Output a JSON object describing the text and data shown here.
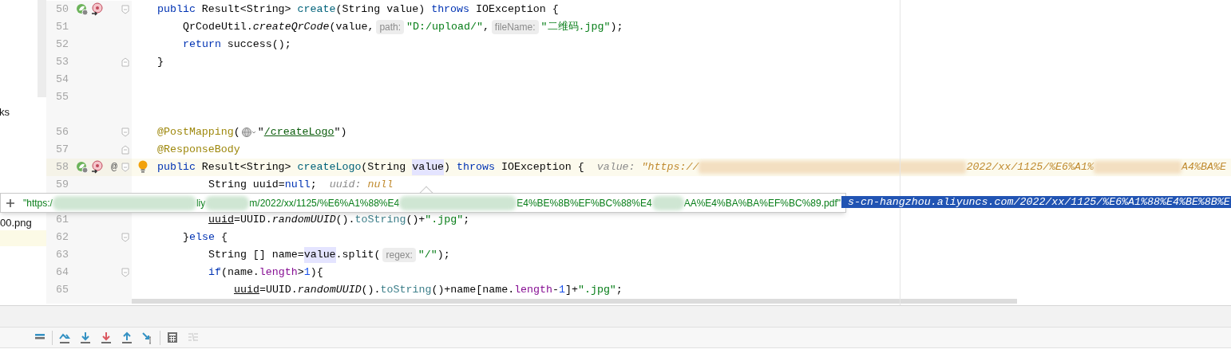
{
  "project_panel": {
    "items": [
      {
        "text": "ks"
      },
      {
        "text": "00.png"
      }
    ]
  },
  "editor": {
    "lines": [
      {
        "number": "50",
        "kind": "member",
        "run_marker": true,
        "impl_marker": true,
        "fold_start": true,
        "highlighted": false,
        "tokens": [
          {
            "kind": "keyword",
            "text": "public"
          },
          {
            "kind": "plain",
            "text": " Result<String> "
          },
          {
            "kind": "method",
            "text": "create"
          },
          {
            "kind": "plain",
            "text": "(String value) "
          },
          {
            "kind": "keyword",
            "text": "throws"
          },
          {
            "kind": "plain",
            "text": " IOException {"
          }
        ]
      },
      {
        "number": "51",
        "kind": "body",
        "highlighted": false,
        "tokens": [
          {
            "kind": "plain",
            "text": "QrCodeUtil."
          },
          {
            "kind": "static",
            "text": "createQrCode"
          },
          {
            "kind": "plain",
            "text": "(value,"
          },
          {
            "kind": "hint",
            "text": "path:"
          },
          {
            "kind": "string",
            "text": "\"D:/upload/\""
          },
          {
            "kind": "plain",
            "text": ","
          },
          {
            "kind": "hint",
            "text": "fileName:"
          },
          {
            "kind": "string",
            "text": "\"二维码.jpg\""
          },
          {
            "kind": "plain",
            "text": ");"
          }
        ]
      },
      {
        "number": "52",
        "kind": "body",
        "highlighted": false,
        "tokens": [
          {
            "kind": "keyword",
            "text": "return"
          },
          {
            "kind": "plain",
            "text": " success();"
          }
        ]
      },
      {
        "number": "53",
        "kind": "member",
        "fold_end": true,
        "highlighted": false,
        "tokens": [
          {
            "kind": "plain",
            "text": "}"
          }
        ]
      },
      {
        "number": "54",
        "kind": "member",
        "highlighted": false
      },
      {
        "number": "55",
        "kind": "member",
        "highlighted": false
      },
      {
        "number": "56",
        "kind": "member",
        "fold_start": true,
        "gap_before": true,
        "highlighted": false,
        "tokens": [
          {
            "kind": "annotation",
            "text": "@PostMapping"
          },
          {
            "kind": "plain",
            "text": "("
          },
          {
            "kind": "globe"
          },
          {
            "kind": "plain",
            "text": "\""
          },
          {
            "kind": "link",
            "text": "/createLogo"
          },
          {
            "kind": "plain",
            "text": "\")"
          }
        ]
      },
      {
        "number": "57",
        "kind": "member",
        "fold_end": true,
        "highlighted": false,
        "tokens": [
          {
            "kind": "annotation",
            "text": "@ResponseBody"
          }
        ]
      },
      {
        "number": "58",
        "kind": "member",
        "run_marker": true,
        "impl_marker": true,
        "mark": "@",
        "bulb": true,
        "fold_start": true,
        "highlighted": true,
        "tokens": [
          {
            "kind": "keyword",
            "text": "public"
          },
          {
            "kind": "plain",
            "text": " Result<String> "
          },
          {
            "kind": "method",
            "text": "createLogo"
          },
          {
            "kind": "plain",
            "text": "(String "
          },
          {
            "kind": "var-highlight",
            "text": "value"
          },
          {
            "kind": "plain",
            "text": ") "
          },
          {
            "kind": "keyword",
            "text": "throws"
          },
          {
            "kind": "plain",
            "text": " IOException {"
          },
          {
            "kind": "debug-label",
            "text": "value:"
          },
          {
            "kind": "debug-value",
            "text": "\"https://"
          },
          {
            "kind": "blur"
          },
          {
            "kind": "debug-value",
            "text": "2022/xx/1125/%E6%A1%"
          },
          {
            "kind": "blur"
          },
          {
            "kind": "debug-value",
            "text": "A4%BA%E"
          }
        ]
      },
      {
        "number": "59",
        "kind": "inner",
        "highlighted": false,
        "tokens": [
          {
            "kind": "plain",
            "text": "String uuid="
          },
          {
            "kind": "keyword",
            "text": "null"
          },
          {
            "kind": "plain",
            "text": ";"
          },
          {
            "kind": "debug-label",
            "text": "uuid:"
          },
          {
            "kind": "debug-value",
            "text": "null"
          }
        ]
      },
      {
        "kind": "covered",
        "selected_tail": "s-cn-hangzhou.aliyuncs.com/2022/xx/1125/%E6%A1%88%E4%BE%8B%E"
      },
      {
        "number": "61",
        "kind": "inner",
        "highlighted": false,
        "tokens": [
          {
            "kind": "var-underline",
            "text": "uuid"
          },
          {
            "kind": "plain",
            "text": "=UUID."
          },
          {
            "kind": "static",
            "text": "randomUUID"
          },
          {
            "kind": "plain",
            "text": "()."
          },
          {
            "kind": "call",
            "text": "toString"
          },
          {
            "kind": "plain",
            "text": "()+"
          },
          {
            "kind": "string",
            "text": "\".jpg\""
          },
          {
            "kind": "plain",
            "text": ";"
          }
        ]
      },
      {
        "number": "62",
        "kind": "body",
        "fold_start": true,
        "highlighted": false,
        "tokens": [
          {
            "kind": "plain",
            "text": "}"
          },
          {
            "kind": "keyword",
            "text": "else"
          },
          {
            "kind": "plain",
            "text": " {"
          }
        ]
      },
      {
        "number": "63",
        "kind": "inner",
        "highlighted": false,
        "tokens": [
          {
            "kind": "plain",
            "text": "String [] name="
          },
          {
            "kind": "var-highlight",
            "text": "value"
          },
          {
            "kind": "plain",
            "text": ".split("
          },
          {
            "kind": "hint",
            "text": "regex:"
          },
          {
            "kind": "string",
            "text": "\"/\""
          },
          {
            "kind": "plain",
            "text": ");"
          }
        ]
      },
      {
        "number": "64",
        "kind": "inner",
        "fold_start": true,
        "highlighted": false,
        "tokens": [
          {
            "kind": "keyword",
            "text": "if"
          },
          {
            "kind": "plain",
            "text": "(name."
          },
          {
            "kind": "field",
            "text": "length"
          },
          {
            "kind": "plain",
            "text": ">"
          },
          {
            "kind": "number",
            "text": "1"
          },
          {
            "kind": "plain",
            "text": "){"
          }
        ]
      },
      {
        "number": "65",
        "kind": "deep",
        "highlighted": false,
        "tokens": [
          {
            "kind": "var-underline",
            "text": "uuid"
          },
          {
            "kind": "plain",
            "text": "=UUID."
          },
          {
            "kind": "static",
            "text": "randomUUID"
          },
          {
            "kind": "plain",
            "text": "()."
          },
          {
            "kind": "call",
            "text": "toString"
          },
          {
            "kind": "plain",
            "text": "()+name[name."
          },
          {
            "kind": "field",
            "text": "length"
          },
          {
            "kind": "plain",
            "text": "-"
          },
          {
            "kind": "number",
            "text": "1"
          },
          {
            "kind": "plain",
            "text": "]+"
          },
          {
            "kind": "string",
            "text": "\".jpg\""
          },
          {
            "kind": "plain",
            "text": ";"
          }
        ]
      }
    ]
  },
  "value_popup": {
    "parts": [
      {
        "kind": "text",
        "text": "\"https:/"
      },
      {
        "kind": "blur"
      },
      {
        "kind": "text",
        "text": "liy"
      },
      {
        "kind": "blur"
      },
      {
        "kind": "text",
        "text": "m/2022/xx/1125/%E6%A1%88%E4"
      },
      {
        "kind": "blur"
      },
      {
        "kind": "text",
        "text": "E4%BE%8B%EF%BC%88%E4"
      },
      {
        "kind": "blur"
      },
      {
        "kind": "text",
        "text": "AA%E4%BA%BA%EF%BC%89.pdf\""
      }
    ]
  },
  "debugger_toolbar": [
    {
      "kind": "menu",
      "disabled": false
    },
    {
      "kind": "step-over",
      "disabled": false
    },
    {
      "kind": "step-into",
      "disabled": false
    },
    {
      "kind": "force-step-into",
      "disabled": false
    },
    {
      "kind": "step-out",
      "disabled": false
    },
    {
      "kind": "run-to-cursor",
      "disabled": false
    },
    {
      "kind": "evaluate",
      "disabled": false
    },
    {
      "kind": "trace",
      "disabled": true
    }
  ]
}
